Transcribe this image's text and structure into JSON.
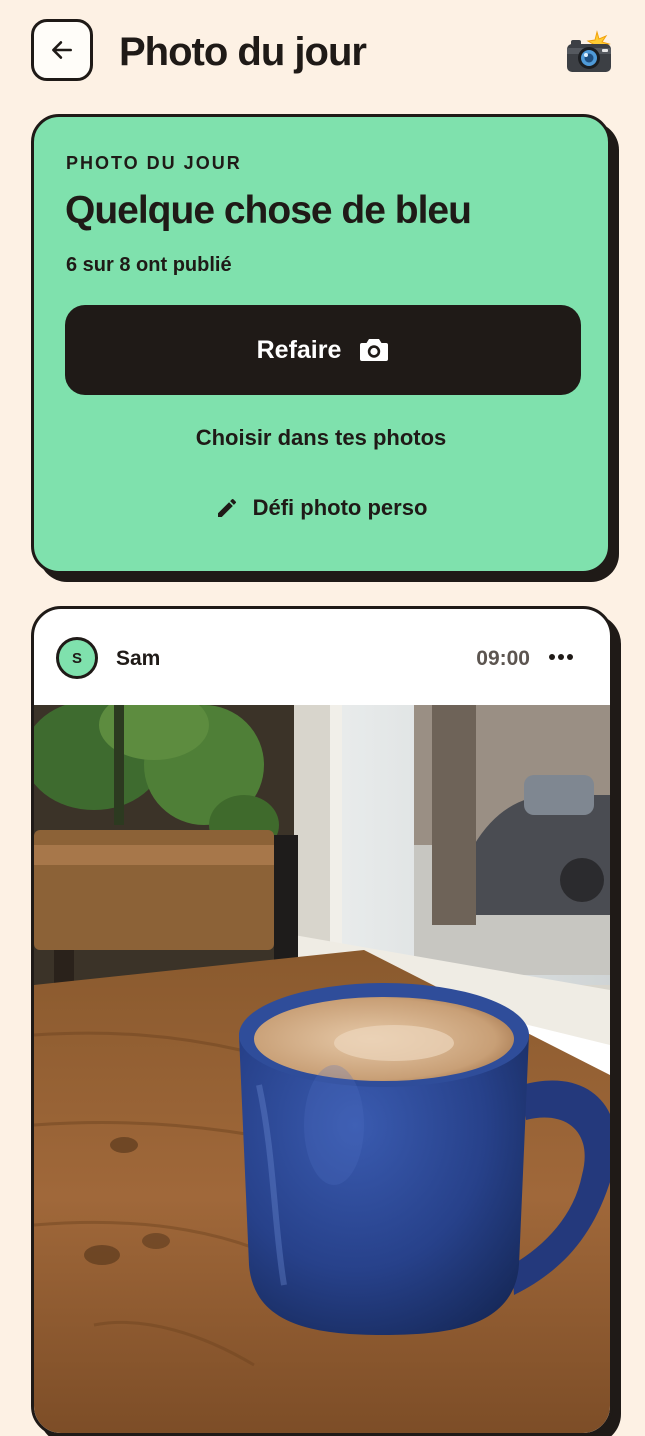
{
  "header": {
    "title": "Photo du jour",
    "back_icon": "arrow-left-icon",
    "emoji_icon": "camera-with-flash-icon"
  },
  "prompt": {
    "eyebrow": "PHOTO DU JOUR",
    "title": "Quelque chose de bleu",
    "progress": "6 sur 8 ont publié",
    "retake_label": "Refaire",
    "retake_icon": "camera-icon",
    "choose_label": "Choisir dans tes photos",
    "custom_label": "Défi photo perso",
    "custom_icon": "pencil-icon"
  },
  "post": {
    "avatar_initial": "S",
    "author": "Sam",
    "time": "09:00",
    "more_icon": "more-horizontal-icon",
    "photo_subject": "blue-coffee-mug-photo"
  },
  "colors": {
    "background": "#fdf1e4",
    "card_green": "#7fe1ad",
    "ink": "#1f1a17",
    "mug_blue": "#27418a"
  }
}
